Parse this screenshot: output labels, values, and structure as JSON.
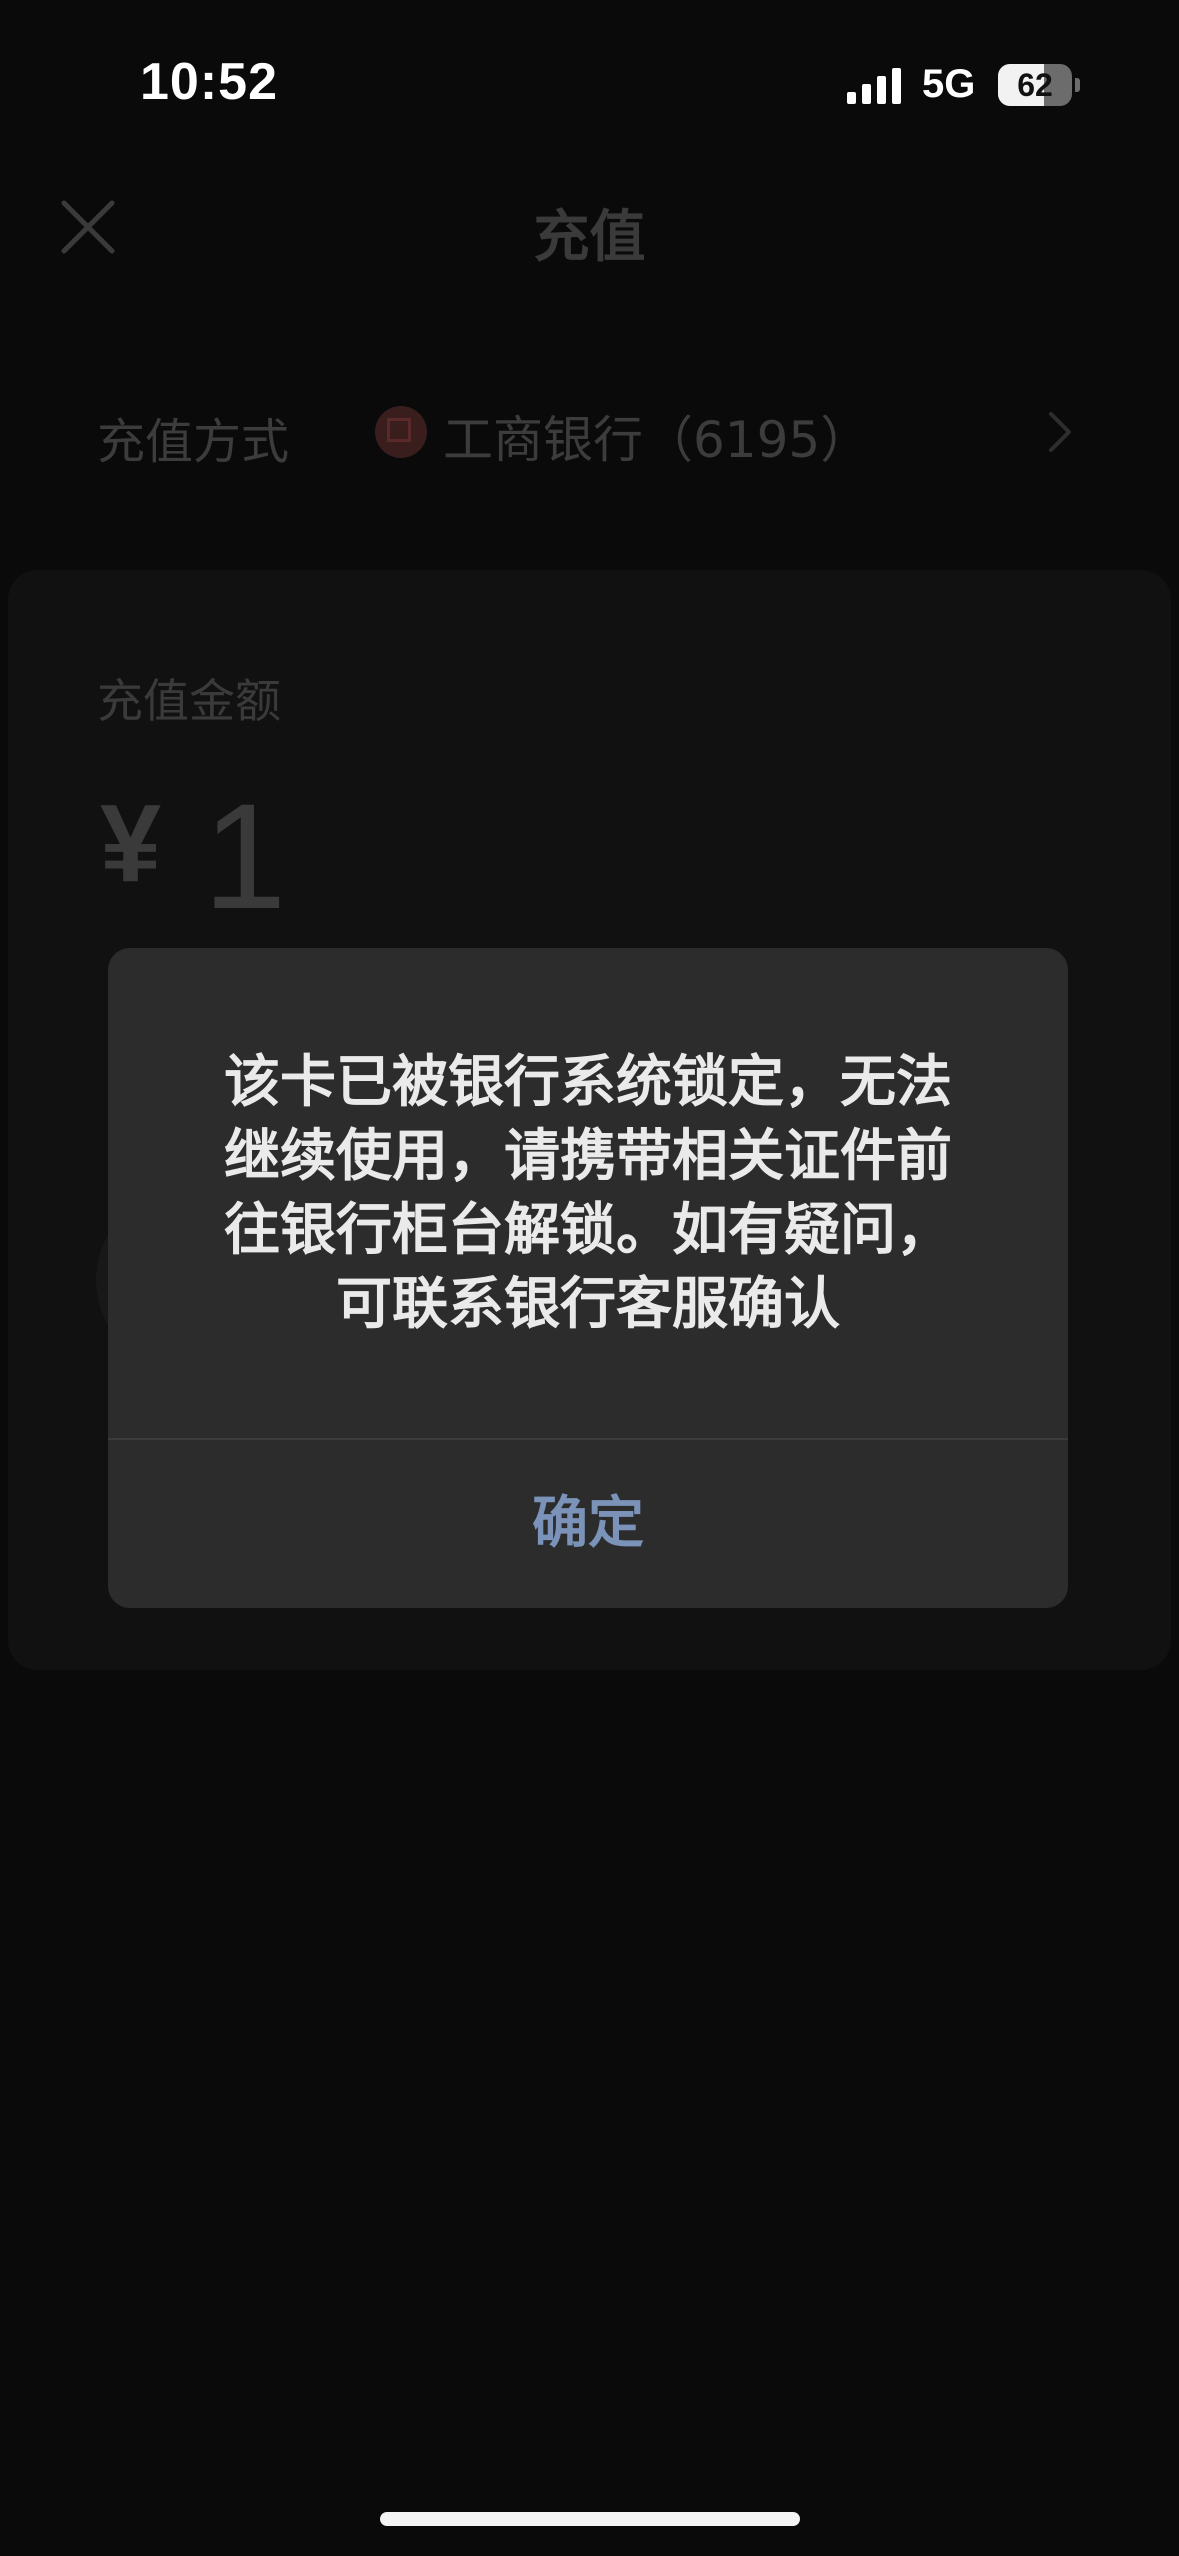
{
  "status_bar": {
    "time": "10:52",
    "network": "5G",
    "battery_level": "62",
    "battery_fraction": 0.62
  },
  "nav": {
    "title": "充值"
  },
  "payment_method": {
    "label": "充值方式",
    "bank": "工商银行（6195）"
  },
  "amount": {
    "label": "充值金额",
    "currency": "¥",
    "value": "1"
  },
  "dialog": {
    "message_lines": [
      "该卡已被银行系统锁定，无法",
      "继续使用，请携带相关证件前",
      "往银行柜台解锁。如有疑问，",
      "可联系银行客服确认"
    ],
    "confirm_label": "确定"
  }
}
